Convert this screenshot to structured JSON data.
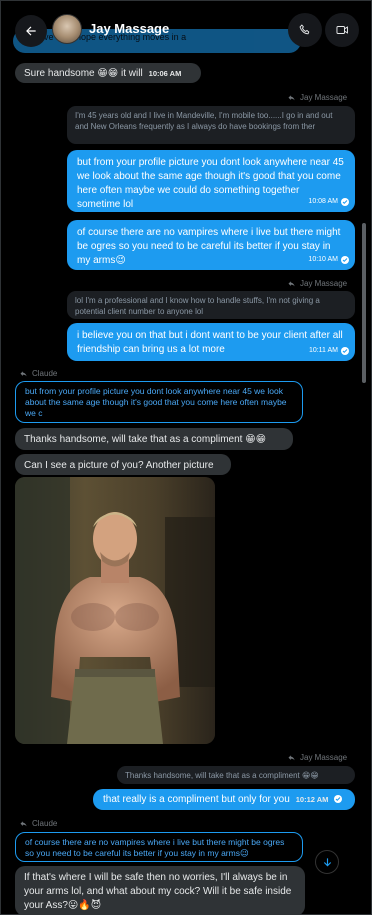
{
  "header": {
    "title": "Jay Massage",
    "peek_text": "positive ab... hope everything moves in a"
  },
  "messages": {
    "m1": {
      "text": "Sure handsome 😁😁 it will",
      "time": "10:06 AM"
    },
    "r1_label": "Jay Massage",
    "q1": "I'm 45 years old and I live in Mandeville, I'm mobile too......I go in and out and New Orleans frequently as I always do have bookings from ther",
    "s1": {
      "text": "but from your profile picture you dont look anywhere near 45 we look about the same age though it's good that you come here often maybe we could do something together sometime lol",
      "time": "10:08 AM"
    },
    "s2": {
      "text": "of course there are no vampires where i live but there might be ogres so you need to be careful its better if you stay in my arms😉",
      "time": "10:10 AM"
    },
    "r2_label": "Jay Massage",
    "q2": "lol I'm a professional and I know how to handle stuffs, I'm not giving a potential client number to anyone lol",
    "s3": {
      "text": "i believe you on that but i dont want to be your client after all friendship can bring us a lot more",
      "time": "10:11 AM"
    },
    "r3_label": "Claude",
    "q3": "but from your profile picture you dont look anywhere near 45 we look about the same age though it's good that you come here often maybe we c",
    "m2": "Thanks handsome, will take that as a compliment 😁😁",
    "m3": "Can I see a picture of you? Another picture",
    "r4_label": "Jay Massage",
    "q4": "Thanks handsome, will take that as a compliment 😁😁",
    "s4": {
      "text": "that really is a compliment but only for you",
      "time": "10:12 AM"
    },
    "r5_label": "Claude",
    "q5": "of course there are no vampires where i live but there might be ogres so you need to be careful its better if you stay in my arms😉",
    "m4": "If that's where I will be safe then no worries, I'll always be in your arms lol, and what about my cock? Will it be safe inside your Ass?😛🔥😈"
  },
  "colors": {
    "sent": "#1d9bf0",
    "received": "#2f3336",
    "background": "#000000"
  },
  "icons": [
    "back-arrow-icon",
    "phone-icon",
    "video-icon",
    "reply-icon",
    "check-icon",
    "arrow-down-icon"
  ]
}
